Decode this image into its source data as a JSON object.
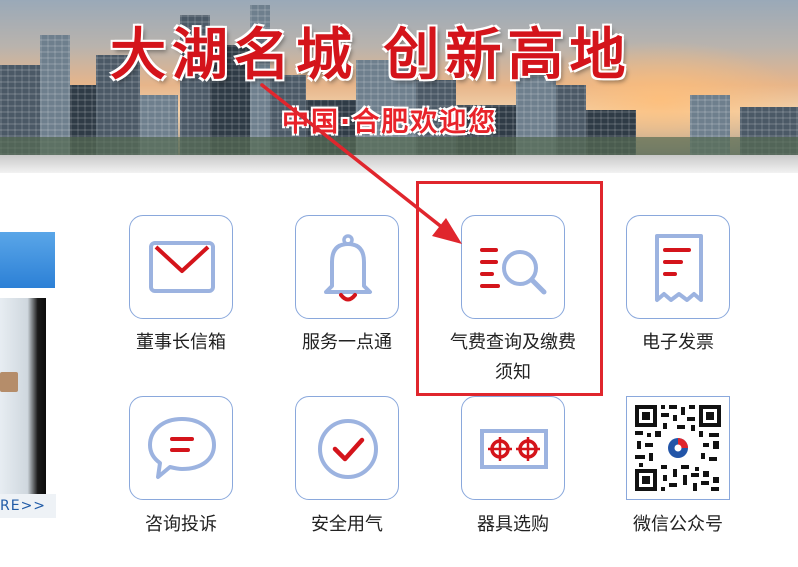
{
  "banner": {
    "headline": "大湖名城 创新高地",
    "subline": "中国·合肥欢迎您"
  },
  "left_panel": {
    "more_link": "RE>>"
  },
  "services": [
    {
      "label": "董事长信箱",
      "icon": "mail-icon"
    },
    {
      "label": "服务一点通",
      "icon": "bell-icon"
    },
    {
      "label": "气费查询及缴费须知",
      "icon": "list-search-icon"
    },
    {
      "label": "电子发票",
      "icon": "invoice-icon"
    },
    {
      "label": "咨询投诉",
      "icon": "chat-icon"
    },
    {
      "label": "安全用气",
      "icon": "check-circle-icon"
    },
    {
      "label": "器具选购",
      "icon": "stove-icon"
    },
    {
      "label": "微信公众号",
      "icon": "qr-code"
    }
  ],
  "colors": {
    "accent_red": "#d4141b",
    "icon_blue": "#8aa8dc",
    "highlight_box": "#e0262d"
  }
}
